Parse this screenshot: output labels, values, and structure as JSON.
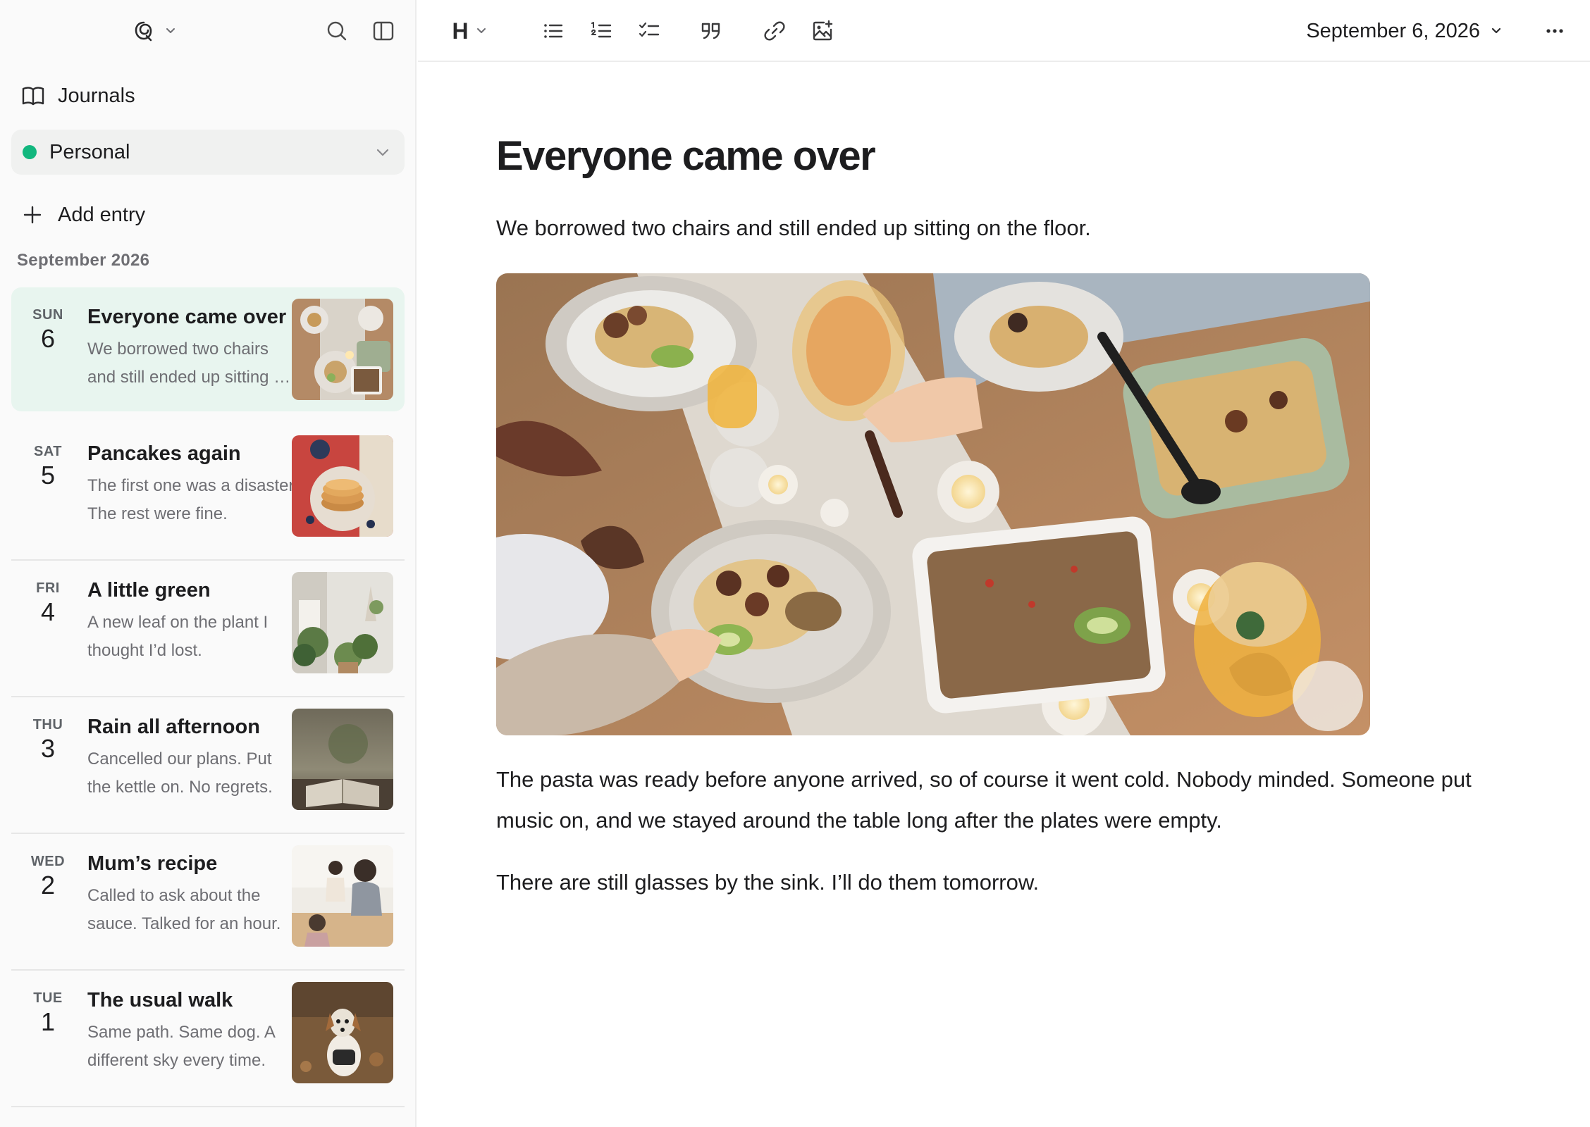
{
  "sidebar": {
    "journals_label": "Journals",
    "journal_selector": {
      "selected": "Personal",
      "dot_color": "#12b77e"
    },
    "add_entry_label": "Add entry",
    "month_heading": "September 2026",
    "entries": [
      {
        "dow": "SUN",
        "day": "6",
        "title": "Everyone came over",
        "snippet": "We borrowed two chairs and still ended up sitting on the floor.",
        "selected": true,
        "thumb": "dinner-table"
      },
      {
        "dow": "SAT",
        "day": "5",
        "title": "Pancakes again",
        "snippet": "The first one was a disaster. The rest were fine.",
        "thumb": "pancakes"
      },
      {
        "dow": "FRI",
        "day": "4",
        "title": "A little green",
        "snippet": "A new leaf on the plant I thought I’d lost.",
        "thumb": "houseplants"
      },
      {
        "dow": "THU",
        "day": "3",
        "title": "Rain all afternoon",
        "snippet": "Cancelled our plans. Put the kettle on. No regrets.",
        "thumb": "open-book"
      },
      {
        "dow": "WED",
        "day": "2",
        "title": "Mum’s recipe",
        "snippet": "Called to ask about the sauce. Talked for an hour.",
        "thumb": "kitchen-family"
      },
      {
        "dow": "TUE",
        "day": "1",
        "title": "The usual walk",
        "snippet": "Same path. Same dog. A different sky every time.",
        "thumb": "dog"
      }
    ]
  },
  "toolbar": {
    "heading_label": "H",
    "date_label": "September 6, 2026"
  },
  "editor": {
    "title": "Everyone came over",
    "subtitle": "We borrowed two chairs and still ended up sitting on the floor.",
    "paragraphs": [
      "The pasta was ready before anyone arrived, so of course it went cold. Nobody minded. Someone put music on, and we stayed around the table long after the plates were empty.",
      "There are still glasses by the sink. I’ll do them tomorrow."
    ]
  },
  "colors": {
    "accent": "#12b77e",
    "selected_bg": "#e8f5ef"
  }
}
